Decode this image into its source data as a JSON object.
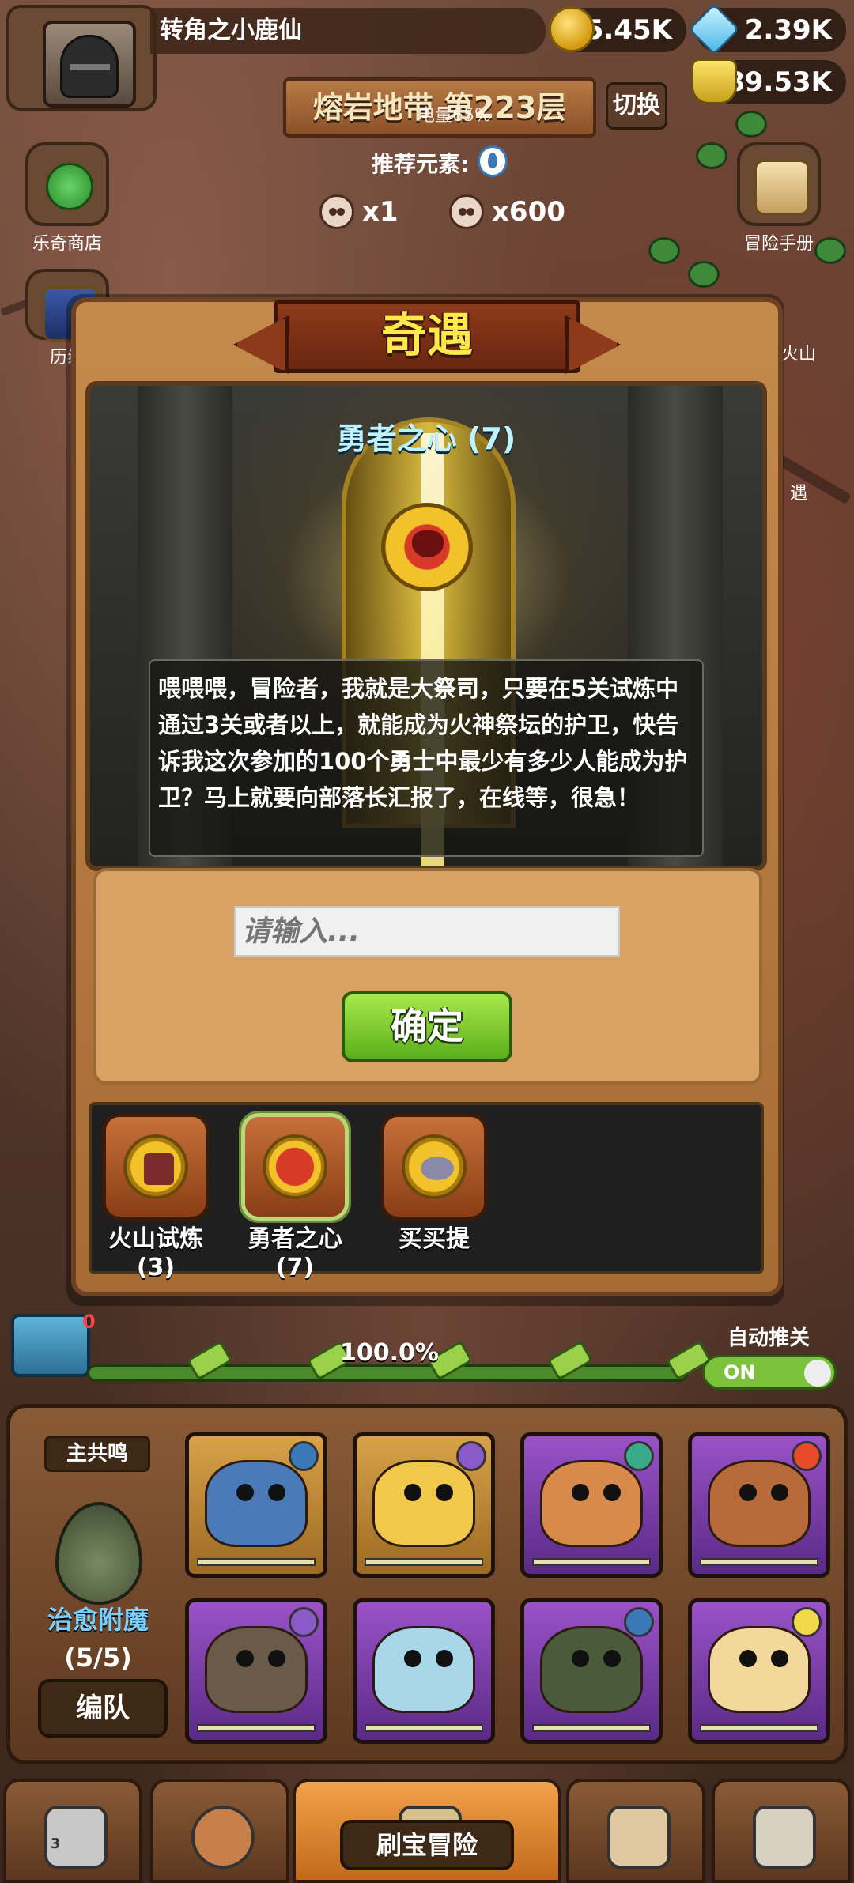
{
  "top": {
    "player_name": "转角之小鹿仙",
    "gold": "85.45K",
    "gems": "2.39K",
    "potions": "89.53K",
    "stage_title": "熔岩地带 第223层",
    "power_overlay": "电量65%",
    "switch_label": "切换",
    "recommend_label": "推荐元素:",
    "kills_a": "x1",
    "kills_b": "x600"
  },
  "side_left": [
    {
      "label": "乐奇商店"
    },
    {
      "label": "历练"
    }
  ],
  "side_right": [
    {
      "label": "冒险手册"
    },
    {
      "label": "火山"
    },
    {
      "label": "遇"
    }
  ],
  "modal": {
    "title": "奇遇",
    "event_name": "勇者之心 (7)",
    "dialog": "喂喂喂，冒险者，我就是大祭司，只要在5关试炼中通过3关或者以上，就能成为火神祭坛的护卫，快告诉我这次参加的100个勇士中最少有多少人能成为护卫？马上就要向部落长汇报了，在线等，很急！",
    "input_placeholder": "请输入...",
    "confirm_label": "确定",
    "events": [
      {
        "label": "火山试炼",
        "count": "(3)"
      },
      {
        "label": "勇者之心",
        "count": "(7)"
      },
      {
        "label": "买买提",
        "count": ""
      }
    ]
  },
  "progress": {
    "chest_count": "0",
    "percent_label": "100.0%",
    "auto_label": "自动推关",
    "toggle_label": "ON",
    "fill_fraction": 1.0
  },
  "heroes": {
    "resonance_label": "主共鸣",
    "enchant_title": "治愈附魔",
    "enchant_count": "(5/5)",
    "team_label": "编队"
  },
  "nav": {
    "active_label": "刷宝冒险",
    "shop_badge": "3"
  },
  "colors": {
    "accent_gold": "#ffe84a",
    "confirm_green": "#5aae1a",
    "event_name_cyan": "#bff2ff"
  }
}
